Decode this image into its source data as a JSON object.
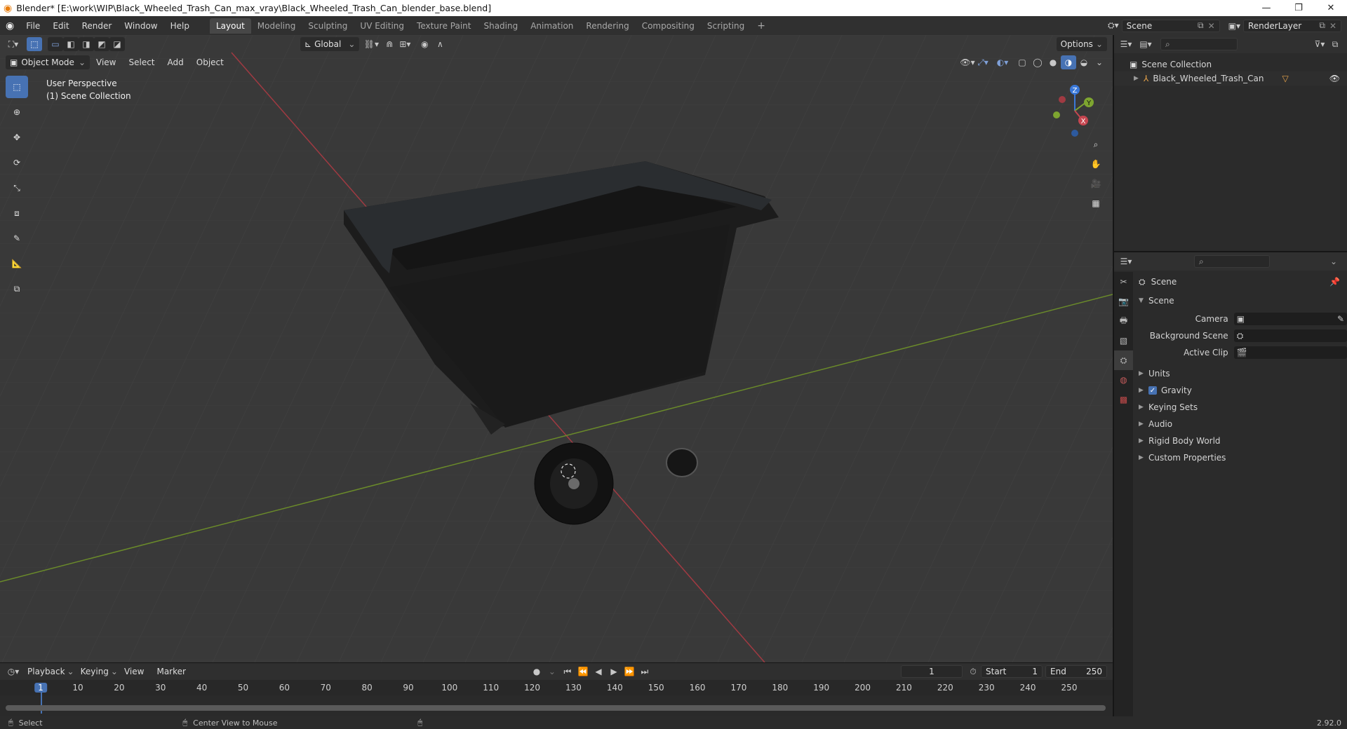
{
  "window": {
    "title": "Blender* [E:\\work\\WIP\\Black_Wheeled_Trash_Can_max_vray\\Black_Wheeled_Trash_Can_blender_base.blend]",
    "minimize": "—",
    "maximize": "❐",
    "close": "✕"
  },
  "menu": [
    "File",
    "Edit",
    "Render",
    "Window",
    "Help"
  ],
  "workspaces": [
    "Layout",
    "Modeling",
    "Sculpting",
    "UV Editing",
    "Texture Paint",
    "Shading",
    "Animation",
    "Rendering",
    "Compositing",
    "Scripting"
  ],
  "add_workspace": "+",
  "scene_field": "Scene",
  "renderlayer_field": "RenderLayer",
  "viewport": {
    "transform_orientation": "Global",
    "options_label": "Options",
    "mode": "Object Mode",
    "header_menu": [
      "View",
      "Select",
      "Add",
      "Object"
    ],
    "overlay_line1": "User Perspective",
    "overlay_line2": "(1) Scene Collection",
    "gizmo": {
      "x": "X",
      "y": "Y",
      "z": "Z"
    }
  },
  "outliner": {
    "collection": "Scene Collection",
    "object": "Black_Wheeled_Trash_Can"
  },
  "properties": {
    "header": "Scene",
    "section": "Scene",
    "rows": [
      {
        "label": "Camera"
      },
      {
        "label": "Background Scene"
      },
      {
        "label": "Active Clip"
      }
    ],
    "panels": [
      "Units",
      "Gravity",
      "Keying Sets",
      "Audio",
      "Rigid Body World",
      "Custom Properties"
    ],
    "gravity_checked": true
  },
  "timeline": {
    "menu": [
      "Playback",
      "Keying",
      "View",
      "Marker"
    ],
    "current_frame": "1",
    "start_label": "Start",
    "start": "1",
    "end_label": "End",
    "end": "250",
    "ticks": [
      "1",
      "10",
      "20",
      "30",
      "40",
      "50",
      "60",
      "70",
      "80",
      "90",
      "100",
      "110",
      "120",
      "130",
      "140",
      "150",
      "160",
      "170",
      "180",
      "190",
      "200",
      "210",
      "220",
      "230",
      "240",
      "250"
    ]
  },
  "status": {
    "select": "Select",
    "center": "Center View to Mouse",
    "version": "2.92.0"
  },
  "colors": {
    "accent": "#4772b3",
    "x_axis": "#c64650",
    "y_axis": "#7ea530",
    "z_axis": "#3a78d8"
  }
}
